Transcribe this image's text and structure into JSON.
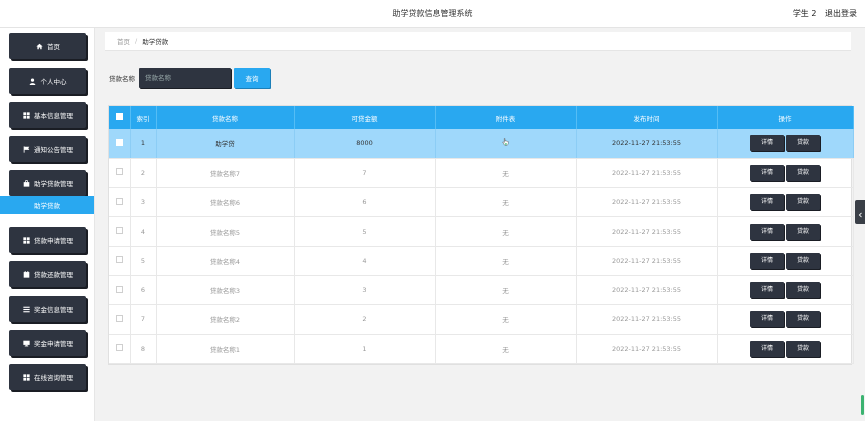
{
  "header": {
    "title": "助学贷款信息管理系统",
    "user": "学生 2",
    "logout": "退出登录"
  },
  "sidebar": {
    "items": [
      {
        "label": "首页",
        "icon": "home-icon"
      },
      {
        "label": "个人中心",
        "icon": "user-icon"
      },
      {
        "label": "基本信息管理",
        "icon": "grid-icon"
      },
      {
        "label": "通知公告管理",
        "icon": "flag-icon"
      },
      {
        "label": "助学贷款管理",
        "icon": "bag-icon"
      },
      {
        "label": "贷款申请管理",
        "icon": "grid-icon"
      },
      {
        "label": "贷款还款管理",
        "icon": "calendar-icon"
      },
      {
        "label": "奖金信息管理",
        "icon": "list-icon"
      },
      {
        "label": "奖金申请管理",
        "icon": "monitor-icon"
      },
      {
        "label": "在线咨询管理",
        "icon": "grid-icon"
      }
    ],
    "active_sub": "助学贷款"
  },
  "breadcrumb": {
    "home": "首页",
    "separator": "/",
    "current": "助学贷款"
  },
  "search": {
    "label": "贷款名称",
    "placeholder": "贷款名称",
    "button": "查询"
  },
  "table": {
    "columns": [
      "索引",
      "贷款名称",
      "可贷金额",
      "附件表",
      "发布时间",
      "操作"
    ],
    "detail_label": "详情",
    "loan_label": "贷款",
    "rows": [
      {
        "index": "1",
        "name": "助学贷",
        "amount": "8000",
        "attachment": "",
        "time": "2022-11-27 21:53:55"
      },
      {
        "index": "2",
        "name": "贷款名称7",
        "amount": "7",
        "attachment": "无",
        "time": "2022-11-27 21:53:55"
      },
      {
        "index": "3",
        "name": "贷款名称6",
        "amount": "6",
        "attachment": "无",
        "time": "2022-11-27 21:53:55"
      },
      {
        "index": "4",
        "name": "贷款名称5",
        "amount": "5",
        "attachment": "无",
        "time": "2022-11-27 21:53:55"
      },
      {
        "index": "5",
        "name": "贷款名称4",
        "amount": "4",
        "attachment": "无",
        "time": "2022-11-27 21:53:55"
      },
      {
        "index": "6",
        "name": "贷款名称3",
        "amount": "3",
        "attachment": "无",
        "time": "2022-11-27 21:53:55"
      },
      {
        "index": "7",
        "name": "贷款名称2",
        "amount": "2",
        "attachment": "无",
        "time": "2022-11-27 21:53:55"
      },
      {
        "index": "8",
        "name": "贷款名称1",
        "amount": "1",
        "attachment": "无",
        "time": "2022-11-27 21:53:55"
      }
    ]
  },
  "colors": {
    "accent": "#29a8f0",
    "dark_button": "#2e3440",
    "highlight_row": "#9fd8fb"
  }
}
